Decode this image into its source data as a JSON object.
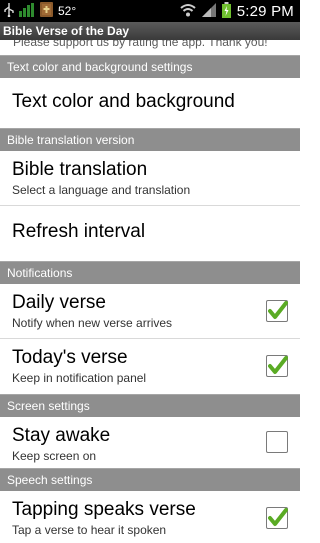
{
  "status_bar": {
    "temperature": "52°",
    "time": "5:29 PM"
  },
  "title": "Bible Verse of the Day",
  "top_cut_text": "Please support us by rating the app. Thank you!",
  "sections": [
    {
      "header": "Text color and background settings",
      "items": [
        {
          "title": "Text color and background",
          "summary": null,
          "checkbox": null
        }
      ]
    },
    {
      "header": "Bible translation version",
      "items": [
        {
          "title": "Bible translation",
          "summary": "Select a language and translation",
          "checkbox": null
        },
        {
          "title": "Refresh interval",
          "summary": null,
          "checkbox": null
        }
      ]
    },
    {
      "header": "Notifications",
      "items": [
        {
          "title": "Daily verse",
          "summary": "Notify when new verse arrives",
          "checkbox": true
        },
        {
          "title": "Today's verse",
          "summary": "Keep in notification panel",
          "checkbox": true
        }
      ]
    },
    {
      "header": "Screen settings",
      "items": [
        {
          "title": "Stay awake",
          "summary": "Keep screen on",
          "checkbox": false
        }
      ]
    },
    {
      "header": "Speech settings",
      "items": [
        {
          "title": "Tapping speaks verse",
          "summary": "Tap a verse to hear it spoken",
          "checkbox": true
        }
      ]
    }
  ],
  "colors": {
    "section_bg": "#8e8e8e",
    "check_green": "#5aab24",
    "title_bar": "#4a4a4a"
  }
}
